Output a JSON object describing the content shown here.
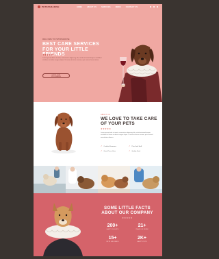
{
  "nav": {
    "logo": "PETSPARADISE",
    "menu": [
      "HOME",
      "ABOUT US",
      "SERVICES",
      "NEWS",
      "CONTACT US"
    ]
  },
  "hero": {
    "eyebrow": "WELCOME TO PETSPARADISE",
    "title": "BEST CARE SERVICES FOR YOUR LITTLE FRIENDS",
    "stars": "★★★★★",
    "text": "Lorem ipsum dolor sit amet, consectetur adipiscing elit, sed do eiusmod tempor incididunt ut labore et dolore magna aliqua. Ut enim ad minim veniam, quis nostrud exercitation.",
    "button_label": "VIEW OUR PROGRAMS"
  },
  "about": {
    "eyebrow": "ABOUT US",
    "title": "WE LOVE TO TAKE CARE OF YOUR PETS",
    "stars": "★★★★★",
    "text": "Lorem ipsum dolor sit amet, consectetur adipiscing elit, sed do eiusmod tempor incididunt ut labore et dolore magna aliqua. Ut enim ad minim veniam, quis nostrud exercitation ullamco.",
    "features": [
      "Certified Groomers",
      "Pets Safe Staff",
      "Great Prices Here",
      "Quality Food"
    ]
  },
  "facts": {
    "title": "SOME LITTLE FACTS ABOUT OUR COMPANY",
    "stars": "★★★★★",
    "stats": [
      {
        "value": "200+",
        "label": "HAPPY CLIENTS"
      },
      {
        "value": "21+",
        "label": "YEARS OF WORK"
      },
      {
        "value": "15+",
        "label": "PETS GROOMED"
      },
      {
        "value": "2K+",
        "label": "HAPPY PETS"
      }
    ]
  },
  "colors": {
    "background": "#3a3430",
    "hero_pink": "#f0a8a2",
    "facts_red": "#d5636a",
    "accent": "#e06a5e"
  }
}
